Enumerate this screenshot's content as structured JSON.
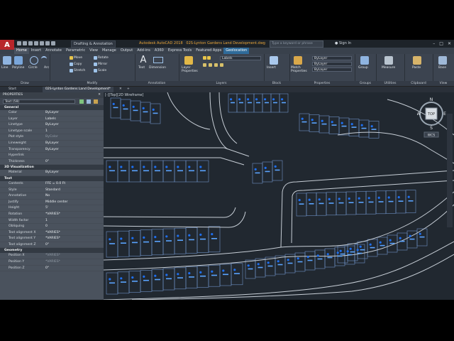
{
  "app": {
    "logo": "A",
    "workspace": "Drafting & Annotation",
    "title_version": "Autodesk AutoCAD 2018",
    "title_file": "02S-Lynton Gardens Land Development.dwg",
    "search_placeholder": "Type a keyword or phrase",
    "sign_in": "Sign In"
  },
  "ribbon_tabs": [
    "Home",
    "Insert",
    "Annotate",
    "Parametric",
    "View",
    "Manage",
    "Output",
    "Add-ins",
    "A360",
    "Express Tools",
    "Featured Apps",
    "Geolocation"
  ],
  "ribbon": {
    "draw": {
      "title": "Draw",
      "tools": [
        "Line",
        "Polyline",
        "Circle",
        "Arc"
      ]
    },
    "modify": {
      "title": "Modify",
      "tools": [
        "Move",
        "Rotate",
        "Copy",
        "Mirror",
        "Stretch",
        "Scale"
      ]
    },
    "annotation": {
      "title": "Annotation",
      "tools": [
        "Text",
        "Dimension"
      ]
    },
    "layers": {
      "title": "Layers",
      "tools": [
        "Layer Properties"
      ],
      "current_layer": "Labels"
    },
    "block": {
      "title": "Block",
      "tools": [
        "Insert"
      ]
    },
    "properties": {
      "title": "Properties",
      "tools": [
        "Match Properties"
      ],
      "combos": [
        "ByLayer",
        "ByLayer",
        "ByLayer"
      ]
    },
    "groups": {
      "title": "Groups",
      "tools": [
        "Group"
      ]
    },
    "utilities": {
      "title": "Utilities",
      "tools": [
        "Measure"
      ]
    },
    "clipboard": {
      "title": "Clipboard",
      "tools": [
        "Paste"
      ]
    },
    "view": {
      "title": "View",
      "tools": [
        "Base"
      ]
    }
  },
  "doc_tabs": {
    "start": "Start",
    "active": "02S-Lynton Gardens Land Development*"
  },
  "properties": {
    "header": "PROPERTIES",
    "selection": "Text (58)",
    "sections": [
      {
        "name": "General",
        "rows": [
          {
            "k": "Color",
            "v": "ByLayer"
          },
          {
            "k": "Layer",
            "v": "Labels"
          },
          {
            "k": "Linetype",
            "v": "ByLayer"
          },
          {
            "k": "Linetype scale",
            "v": "1"
          },
          {
            "k": "Plot style",
            "v": "ByColor"
          },
          {
            "k": "Lineweight",
            "v": "ByLayer"
          },
          {
            "k": "Transparency",
            "v": "ByLayer"
          },
          {
            "k": "Hyperlink",
            "v": ""
          },
          {
            "k": "Thickness",
            "v": "0\""
          }
        ]
      },
      {
        "name": "3D Visualization",
        "rows": [
          {
            "k": "Material",
            "v": "ByLayer"
          }
        ]
      },
      {
        "name": "Text",
        "rows": [
          {
            "k": "Contents",
            "v": "FFE = 0.0 Ft"
          },
          {
            "k": "Style",
            "v": "Standard"
          },
          {
            "k": "Annotative",
            "v": "No"
          },
          {
            "k": "Justify",
            "v": "Middle center"
          },
          {
            "k": "Height",
            "v": "5'"
          },
          {
            "k": "Rotation",
            "v": "*VARIES*"
          },
          {
            "k": "Width factor",
            "v": "1"
          },
          {
            "k": "Obliquing",
            "v": "0"
          },
          {
            "k": "Text alignment X",
            "v": "*VARIES*"
          },
          {
            "k": "Text alignment Y",
            "v": "*VARIES*"
          },
          {
            "k": "Text alignment Z",
            "v": "0\""
          }
        ]
      },
      {
        "name": "Geometry",
        "rows": [
          {
            "k": "Position X",
            "v": "*VARIES*"
          },
          {
            "k": "Position Y",
            "v": "*VARIES*"
          },
          {
            "k": "Position Z",
            "v": "0\""
          }
        ]
      }
    ]
  },
  "viewport": {
    "label": "[-][Top][2D Wireframe]"
  },
  "viewcube": {
    "face": "TOP",
    "n": "N",
    "s": "S",
    "e": "E",
    "w": "W",
    "wcs": "WCS"
  },
  "colors": {
    "accent": "#e8a53a",
    "lot_lines": "#6d8fc4",
    "road": "#c7ced6",
    "text": "#5aa4ff",
    "highlight": "#1e6ff0",
    "canvas": "#212830"
  }
}
